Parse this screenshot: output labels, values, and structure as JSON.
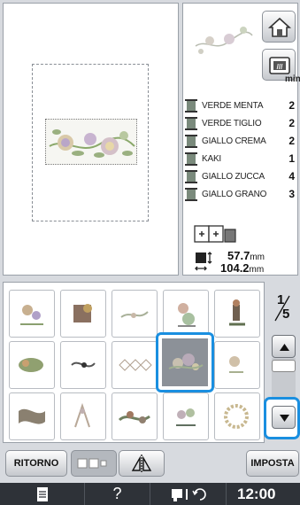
{
  "threads": {
    "column_header": "min",
    "items": [
      {
        "name": "VERDE MENTA",
        "minutes": "2",
        "color": "#7a8a7c"
      },
      {
        "name": "VERDE TIGLIO",
        "minutes": "2",
        "color": "#7a8a7c"
      },
      {
        "name": "GIALLO CREMA",
        "minutes": "2",
        "color": "#7a8a7c"
      },
      {
        "name": "KAKI",
        "minutes": "1",
        "color": "#7a8a7c"
      },
      {
        "name": "GIALLO ZUCCA",
        "minutes": "4",
        "color": "#7a8a7c"
      },
      {
        "name": "GIALLO GRANO",
        "minutes": "3",
        "color": "#7a8a7c"
      }
    ]
  },
  "size": {
    "height_value": "57.7",
    "height_unit": "mm",
    "width_value": "104.2",
    "width_unit": "mm"
  },
  "pager": {
    "current": "1",
    "total": "5"
  },
  "buttons": {
    "ritorno": "RITORNO",
    "imposta": "IMPOSTA"
  },
  "status_bar": {
    "help_glyph": "?",
    "clock": "12:00"
  },
  "colors": {
    "selection_accent": "#1a8fe0",
    "status_bar_bg": "#2e3238"
  },
  "icons": [
    "home-icon",
    "embroidery-frame-icon",
    "thread-spool-icon",
    "layout-icon",
    "size-icon",
    "scroll-up-icon",
    "scroll-down-icon",
    "multi-select-icon",
    "mirror-icon",
    "document-icon",
    "help-icon",
    "machine-icon"
  ]
}
